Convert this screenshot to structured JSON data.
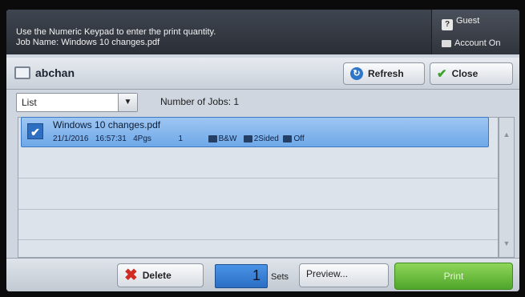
{
  "header": {
    "instruction_line1": "Use the Numeric Keypad to enter the print quantity.",
    "instruction_line2": "Job Name: Windows 10 changes.pdf",
    "guest_label": "Guest",
    "account_label": "Account On"
  },
  "toolbar": {
    "user_name": "abchan",
    "refresh_label": "Refresh",
    "close_label": "Close"
  },
  "filter": {
    "selected_view": "List",
    "jobs_count_label": "Number of Jobs: 1"
  },
  "jobs": [
    {
      "name": "Windows 10 changes.pdf",
      "date": "21/1/2016",
      "time": "16:57:31",
      "pages": "4Pgs",
      "copies": "1",
      "color_mode": "B&W",
      "sided": "2Sided",
      "staple": "Off",
      "selected": true
    }
  ],
  "bottom": {
    "delete_label": "Delete",
    "quantity": "1",
    "sets_label": "Sets",
    "preview_label": "Preview...",
    "print_label": "Print"
  },
  "colors": {
    "header_bg": "#2e333b",
    "selected_row": "#6ea8e8",
    "quantity_bg": "#2a6fc4",
    "print_button": "#4ea62a",
    "delete_icon": "#d12c23",
    "close_check": "#3aa12b"
  },
  "icons": {
    "guest": "question-badge-icon",
    "account": "keypad-icon",
    "user": "printer-user-icon",
    "refresh": "refresh-icon",
    "close": "checkmark-icon",
    "dropdown": "chevron-down-icon",
    "job_check": "checkmark-icon",
    "delete": "x-icon"
  }
}
